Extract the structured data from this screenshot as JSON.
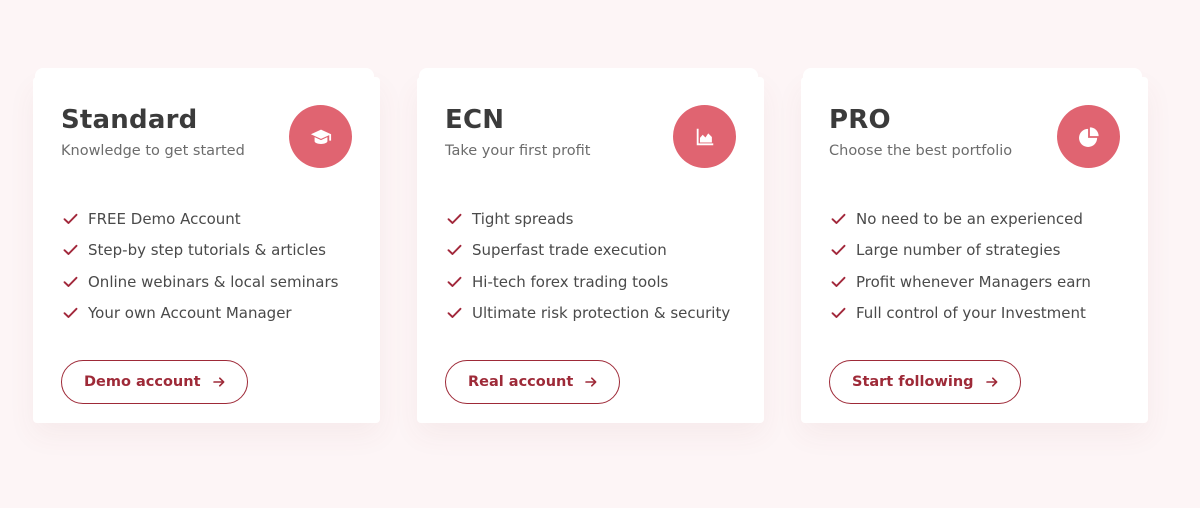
{
  "colors": {
    "accent": "#e06471",
    "button_text": "#9e2a38",
    "background": "#fdf5f6",
    "check": "#a2283b"
  },
  "plans": [
    {
      "title": "Standard",
      "subtitle": "Knowledge to get started",
      "icon": "graduation-cap-icon",
      "features": [
        "FREE Demo Account",
        "Step-by step tutorials & articles",
        "Online webinars & local seminars",
        "Your own Account Manager"
      ],
      "button_label": "Demo account"
    },
    {
      "title": "ECN",
      "subtitle": "Take your first profit",
      "icon": "area-chart-icon",
      "features": [
        "Tight spreads",
        "Superfast trade execution",
        "Hi-tech forex trading tools",
        "Ultimate risk protection & security"
      ],
      "button_label": "Real account"
    },
    {
      "title": "PRO",
      "subtitle": "Choose the best portfolio",
      "icon": "pie-chart-icon",
      "features": [
        "No need to be an experienced",
        "Large number of strategies",
        "Profit whenever Managers earn",
        "Full control of your Investment"
      ],
      "button_label": "Start following"
    }
  ]
}
